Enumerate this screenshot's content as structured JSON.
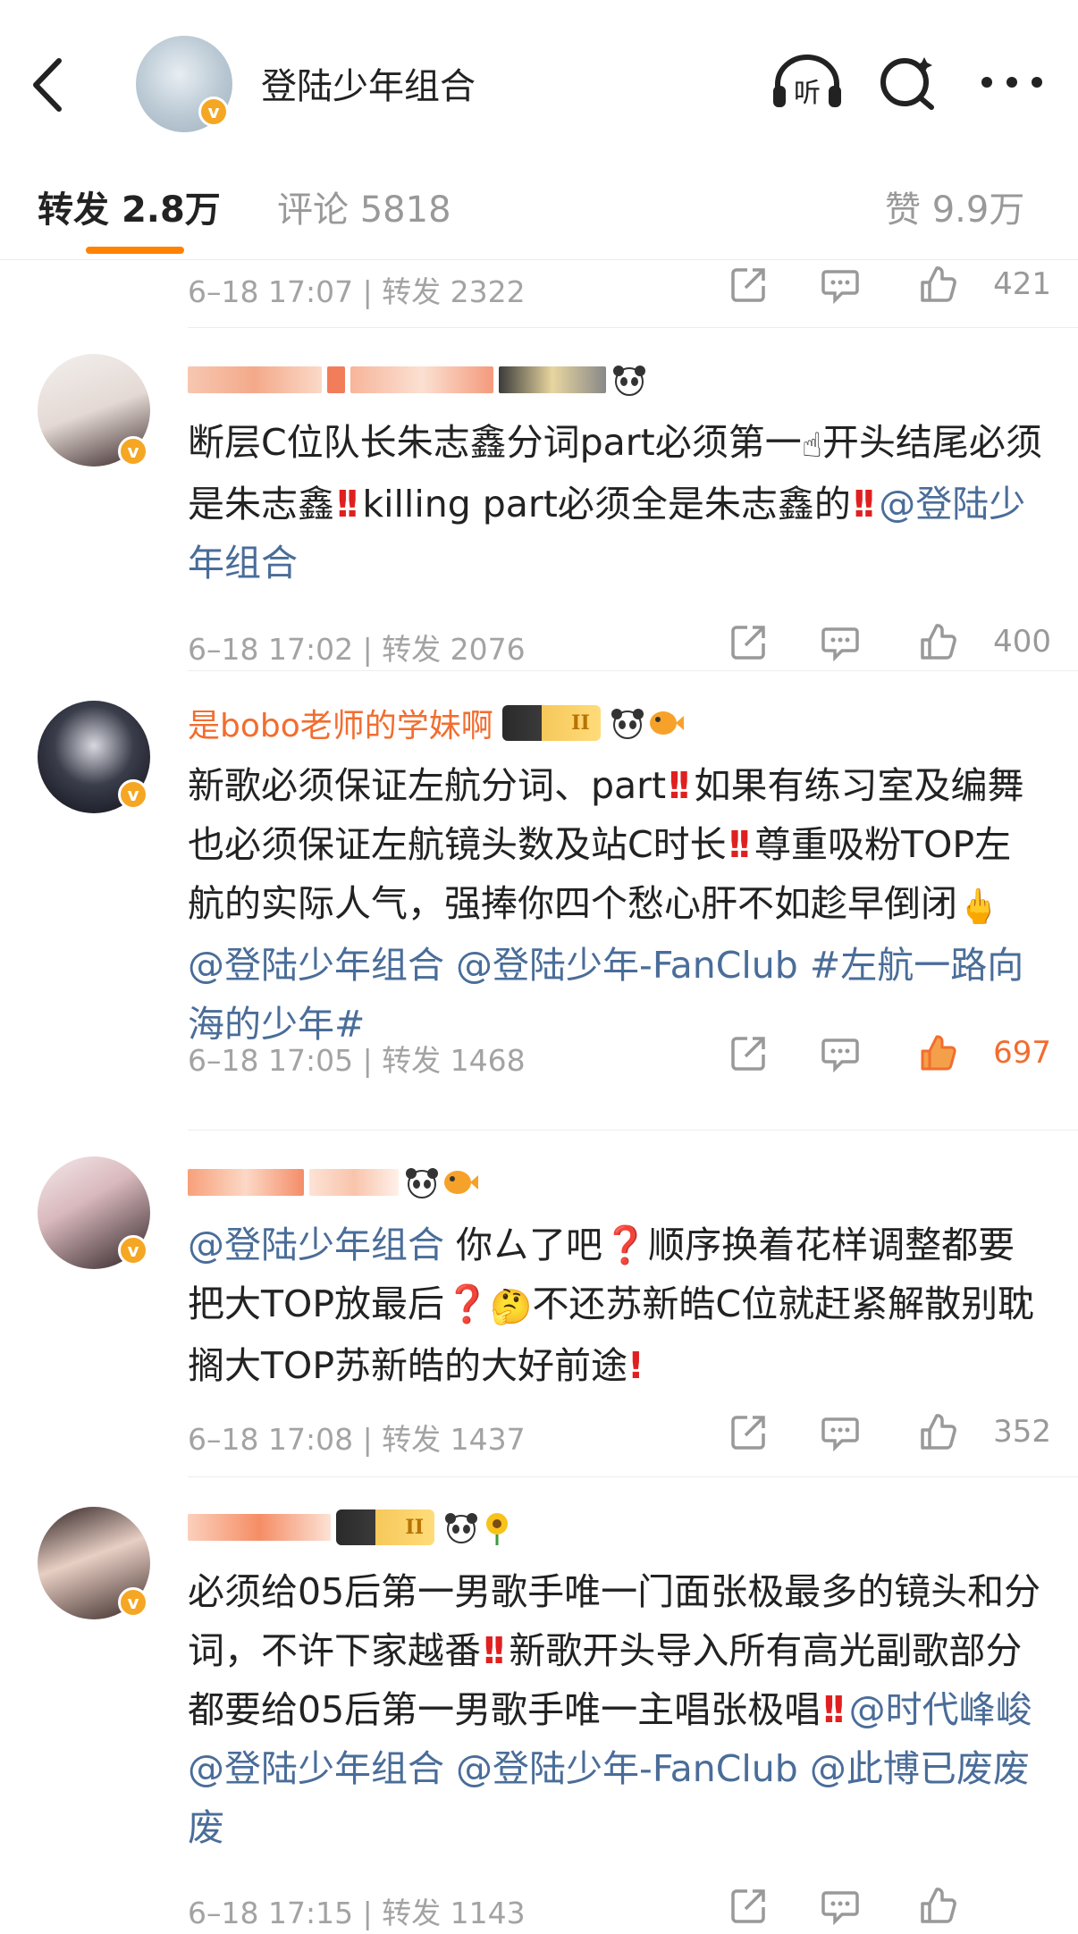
{
  "header": {
    "account_name": "登陆少年组合",
    "verified_mark": "v",
    "listen_label": "听",
    "icons": [
      "back-arrow-icon",
      "listen-headphone-icon",
      "search-icon",
      "more-dots-icon"
    ]
  },
  "tabs": [
    {
      "label": "转发",
      "count": "2.8万"
    },
    {
      "label": "评论",
      "count": "5818"
    },
    {
      "label": "赞",
      "count": "9.9万"
    }
  ],
  "colors": {
    "accent": "#ff8200",
    "link": "#4a6d99",
    "username": "#f26d2f",
    "alert": "#e02020"
  },
  "first_row": {
    "meta": "6–18 17:07 | 转发 2322",
    "likes": "421"
  },
  "comments": [
    {
      "username": "",
      "text_parts": [
        "断层C位队长朱志鑫分词part必须第一",
        "开头结尾必须是朱志鑫",
        "killing part必须全是朱志鑫的",
        "@登陆少年组合"
      ],
      "meta": "6–18 17:02 | 转发 2076",
      "likes": "400"
    },
    {
      "username": "是bobo老师的学妹啊",
      "badge": "II",
      "text_parts": [
        "新歌必须保证左航分词、part",
        "如果有练习室及编舞也必须保证左航镜头数及站C时长",
        "尊重吸粉TOP左航的实际人气，强捧你四个愁心肝不如趁早倒闭",
        "@登陆少年组合",
        "@登陆少年-FanClub",
        "#左航一路向海的少年#"
      ],
      "meta": "6–18 17:05 | 转发 1468",
      "likes": "697"
    },
    {
      "username": "",
      "text_parts": [
        "@登陆少年组合",
        "你ㄙ了吧",
        "顺序换着花样调整都要把大TOP放最后",
        "不还苏新皓C位就赶紧解散别耽搁大TOP苏新皓的大好前途"
      ],
      "meta": "6–18 17:08 | 转发 1437",
      "likes": "352"
    },
    {
      "username": "",
      "badge": "II",
      "text_parts": [
        "必须给05后第一男歌手唯一门面张极最多的镜头和分词，不许下家越番",
        "新歌开头导入所有高光副歌部分都要给05后第一男歌手唯一主唱张极唱",
        "@时代峰峻",
        "@登陆少年组合",
        "@登陆少年-FanClub",
        "@此博已废废废"
      ],
      "meta": "6–18 17:15 | 转发 1143",
      "likes": ""
    }
  ]
}
